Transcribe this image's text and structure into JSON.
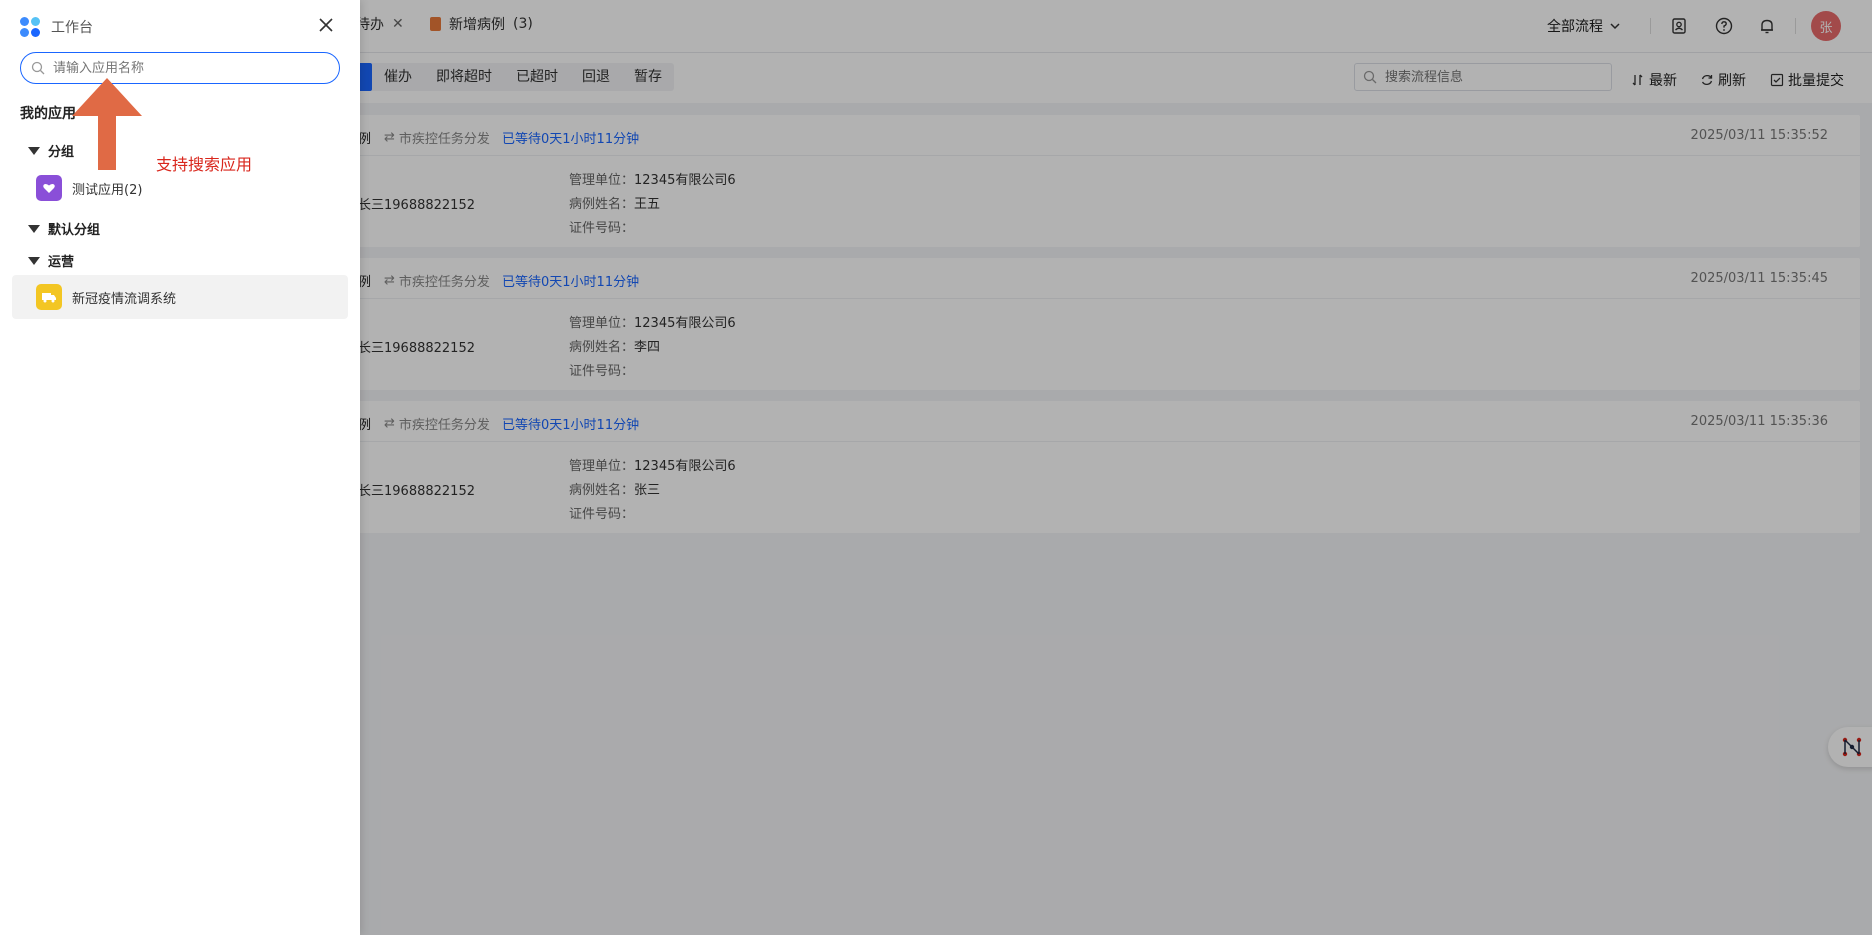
{
  "tabs": [
    {
      "label": "待办",
      "closable": true
    },
    {
      "label": "新增病例",
      "count": "(3)"
    }
  ],
  "header": {
    "flow_select": "全部流程",
    "avatar_text": "张"
  },
  "filters": {
    "buttons": [
      "催办",
      "即将超时",
      "已超时",
      "回退",
      "暂存"
    ],
    "search_placeholder": "搜索流程信息",
    "actions": {
      "latest": "最新",
      "refresh": "刷新",
      "batch_submit": "批量提交"
    }
  },
  "cards": [
    {
      "title": "例",
      "task": "市疾控任务分发",
      "wait": "已等待0天1小时11分钟",
      "time": "2025/03/11 15:35:52",
      "phone": "长三19688822152",
      "fields": [
        {
          "k": "管理单位：",
          "v": "12345有限公司6"
        },
        {
          "k": "病例姓名：",
          "v": "王五"
        },
        {
          "k": "证件号码：",
          "v": ""
        }
      ]
    },
    {
      "title": "例",
      "task": "市疾控任务分发",
      "wait": "已等待0天1小时11分钟",
      "time": "2025/03/11 15:35:45",
      "phone": "长三19688822152",
      "fields": [
        {
          "k": "管理单位：",
          "v": "12345有限公司6"
        },
        {
          "k": "病例姓名：",
          "v": "李四"
        },
        {
          "k": "证件号码：",
          "v": ""
        }
      ]
    },
    {
      "title": "例",
      "task": "市疾控任务分发",
      "wait": "已等待0天1小时11分钟",
      "time": "2025/03/11 15:35:36",
      "phone": "长三19688822152",
      "fields": [
        {
          "k": "管理单位：",
          "v": "12345有限公司6"
        },
        {
          "k": "病例姓名：",
          "v": "张三"
        },
        {
          "k": "证件号码：",
          "v": ""
        }
      ]
    }
  ],
  "drawer": {
    "title": "工作台",
    "search_placeholder": "请输入应用名称",
    "section_title": "我的应用",
    "groups": [
      {
        "name": "分组",
        "apps": [
          {
            "name": "测试应用(2)",
            "icon": "heart-icon",
            "color": "#8a4fd8"
          }
        ]
      },
      {
        "name": "默认分组",
        "apps": []
      },
      {
        "name": "运营",
        "apps": [
          {
            "name": "新冠疫情流调系统",
            "icon": "truck-icon",
            "color": "#f3c623"
          }
        ]
      }
    ],
    "annotation": "支持搜索应用"
  },
  "colors": {
    "primary": "#1a66ff",
    "annotation": "#d9261c",
    "arrow": "#e06a45"
  }
}
